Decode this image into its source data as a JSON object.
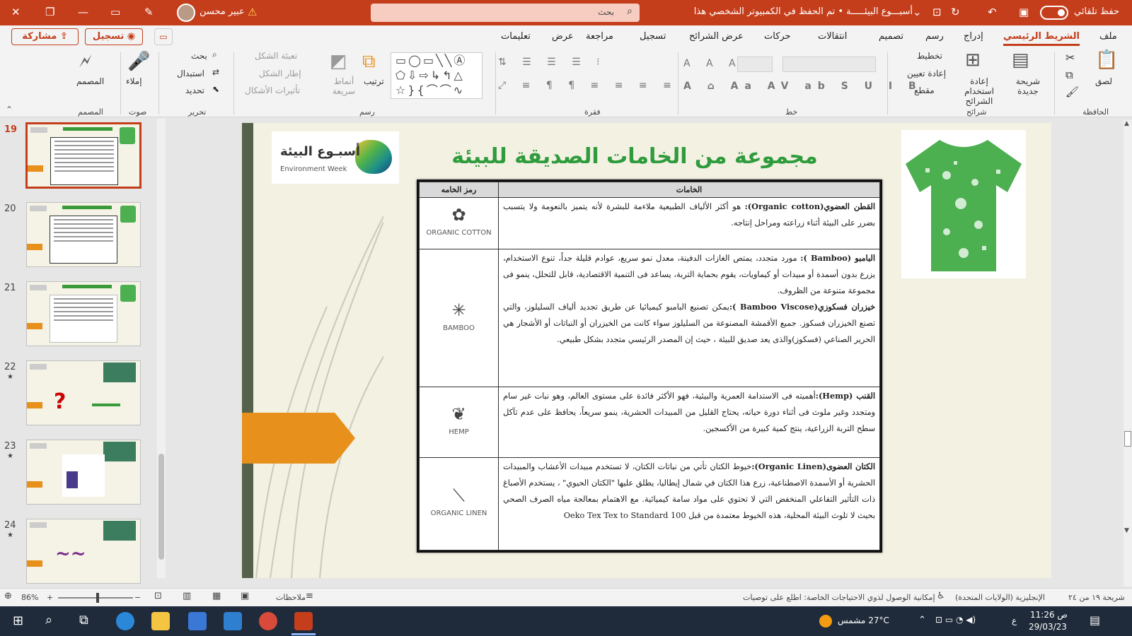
{
  "titlebar": {
    "autosave_label": "حفظ تلقائي",
    "document_title": "أسبـــوع البيئـــــة • تم الحفظ في الكمبيوتر الشخصي هذا",
    "search_placeholder": "بحث",
    "user_name": "عبير محسن",
    "colors": {
      "brand": "#c43e1c"
    }
  },
  "tabs": {
    "items": [
      "ملف",
      "الشريط الرئيسي",
      "إدراج",
      "رسم",
      "تصميم",
      "انتقالات",
      "حركات",
      "عرض الشرائح",
      "تسجيل",
      "مراجعة",
      "عرض",
      "تعليمات"
    ],
    "active": "الشريط الرئيسي",
    "share_label": "مشاركة",
    "record_label": "تسجيل"
  },
  "ribbon": {
    "clipboard": {
      "group": "الحافظة",
      "paste": "لصق"
    },
    "slides": {
      "group": "شرائح",
      "new_slide": "شريحة جديدة",
      "reuse": "إعادة استخدام الشرائح",
      "layout": "تخطيط",
      "reset": "إعادة تعيين",
      "section": "مقطع"
    },
    "font": {
      "group": "خط"
    },
    "paragraph": {
      "group": "فقرة"
    },
    "drawing": {
      "group": "رسم",
      "arrange": "ترتيب",
      "styles": "أنماط سريعة",
      "fill": "تعبئة الشكل",
      "outline": "إطار الشكل",
      "effects": "تأثيرات الأشكال"
    },
    "editing": {
      "group": "تحرير",
      "find": "بحث",
      "replace": "استبدال",
      "select": "تحديد"
    },
    "voice": {
      "group": "صوت",
      "dictate": "إملاء"
    },
    "designer": {
      "group": "المصمم",
      "designer": "المصمم"
    }
  },
  "thumbnails": {
    "numbers": [
      "19",
      "20",
      "21",
      "22",
      "23",
      "24"
    ],
    "selected": "19"
  },
  "slide": {
    "title": "مجموعة من الخامات الصديقة للبيئة",
    "logo_ar": "أسبـوع البيئة",
    "logo_en": "Environment Week",
    "table": {
      "headers": [
        "الخامات",
        "رمز الخامه"
      ],
      "rows": [
        {
          "symbol_label": "ORGANIC COTTON",
          "term": "القطن العضوي(Organic cotton):",
          "text": " هو أكثر الألياف الطبيعية ملاءمة للبشرة لأنه يتميز بالنعومة ولا يتسبب بضرر على البيئة أثناء زراعته ومراحل إنتاجه."
        },
        {
          "symbol_label": "BAMBOO",
          "term": "البامبو (Bamboo ):",
          "text": " مورد متجدد، يمتص الغازات الدفينة، معدل نمو سريع، عوادم قليلة جداً، تنوع الاستخدام، يزرع بدون أسمدة أو مبيدات أو كيماويات، يقوم بحماية التربة، يساعد فى التنمية الاقتصادية، قابل للتحلل، ينمو فى مجموعة متنوعة من الظروف.",
          "term2": "خيزران فسكوزي(Bamboo Viscose ):",
          "text2": "يمكن تصنيع البامبو كيميائيا عن طريق تجديد ألياف السليلوز، والتي تصنع الخيزران فسكوز. جميع الأقمشة المصنوعة من السليلوز سواء كانت من الخيزران أو النباتات أو الأشجار هي الحرير الصناعي (فسكوز)والذى يعد صديق للبيئة ، حيث إن المصدر الرئيسي متجدد بشكل طبيعي."
        },
        {
          "symbol_label": "HEMP",
          "term": "القنب (Hemp):",
          "text": "أهميته فى الاستدامة العمرية والبيئية، فهو الأكثر فائدة على مستوى العالم، وهو نبات غير سام ومتجدد وغير ملوث فى أثناء دورة حياته، يحتاج القليل من المبيدات الحشرية، ينمو سريعاً، يحافظ على عدم تآكل سطح التربة الزراعية، ينتج كمية كبيرة من الأكسجين."
        },
        {
          "symbol_label": "ORGANIC LINEN",
          "term": "الكتان العضوى(Organic Linen):",
          "text": "خيوط الكتان تأتي من نباتات الكتان، لا تستخدم مبيدات الأعشاب والمبيدات الحشرية أو الأسمدة الاصطناعية، زرع هذا الكتان في شمال إيطاليا، يطلق عليها \"الكتان الحيوي\" ، يستخدم الأصباغ ذات التأثير التفاعلي المنخفض التي لا تحتوي على مواد سامة كيميائية. مع الاهتمام بمعالجة مياه الصرف الصحي بحيث لا تلوث البيئة المحلية، هذه الخيوط معتمدة من قبل Oeko Tex Tex to Standard 100"
        }
      ]
    }
  },
  "statusbar": {
    "slide_info": "شريحة ١٩ من ٢٤",
    "language": "الإنجليزية (الولايات المتحدة)",
    "accessibility": "إمكانية الوصول لذوي الاحتياجات الخاصة: اطلع على توصيات",
    "notes": "ملاحظات",
    "zoom": "86%"
  },
  "taskbar": {
    "weather": "27°C مشمس",
    "time": "11:26 ص",
    "date": "29/03/23",
    "lang": "ع"
  }
}
